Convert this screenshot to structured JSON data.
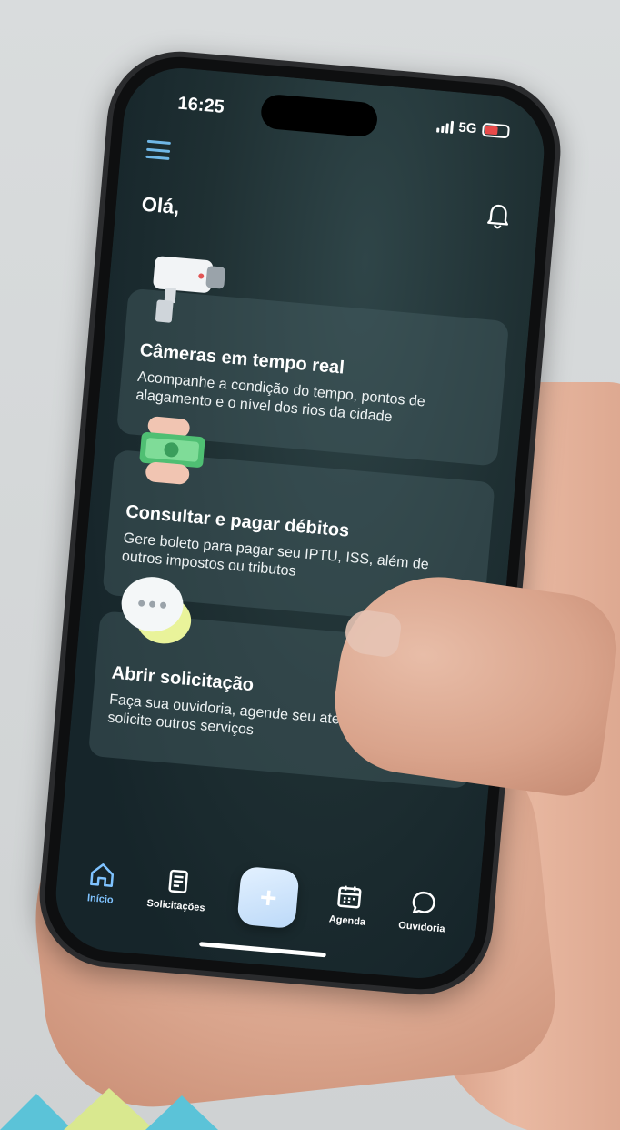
{
  "status_bar": {
    "time": "16:25",
    "network": "5G"
  },
  "header": {
    "greeting": "Olá,"
  },
  "cards": [
    {
      "title": "Câmeras em tempo real",
      "description": "Acompanhe a condição do tempo, pontos de alagamento e o nível dos rios da cidade",
      "icon": "camera-icon"
    },
    {
      "title": "Consultar e pagar débitos",
      "description": "Gere boleto para pagar seu IPTU, ISS, além de outros impostos ou tributos",
      "icon": "payment-icon"
    },
    {
      "title": "Abrir solicitação",
      "description": "Faça sua ouvidoria, agende seu atendimento ou solicite outros serviços",
      "icon": "chat-bubble-icon"
    }
  ],
  "tabbar": {
    "items": [
      {
        "label": "Início",
        "icon": "home-icon",
        "active": true
      },
      {
        "label": "Solicitações",
        "icon": "document-icon",
        "active": false
      },
      {
        "label": "",
        "icon": "plus-icon",
        "active": false
      },
      {
        "label": "Agenda",
        "icon": "calendar-icon",
        "active": false
      },
      {
        "label": "Ouvidoria",
        "icon": "chat-icon",
        "active": false
      }
    ]
  },
  "colors": {
    "screen_bg": "#1f3033",
    "accent": "#7fc3ff",
    "menu_icon": "#6fb6e6",
    "fab": "#cfe6ff"
  }
}
